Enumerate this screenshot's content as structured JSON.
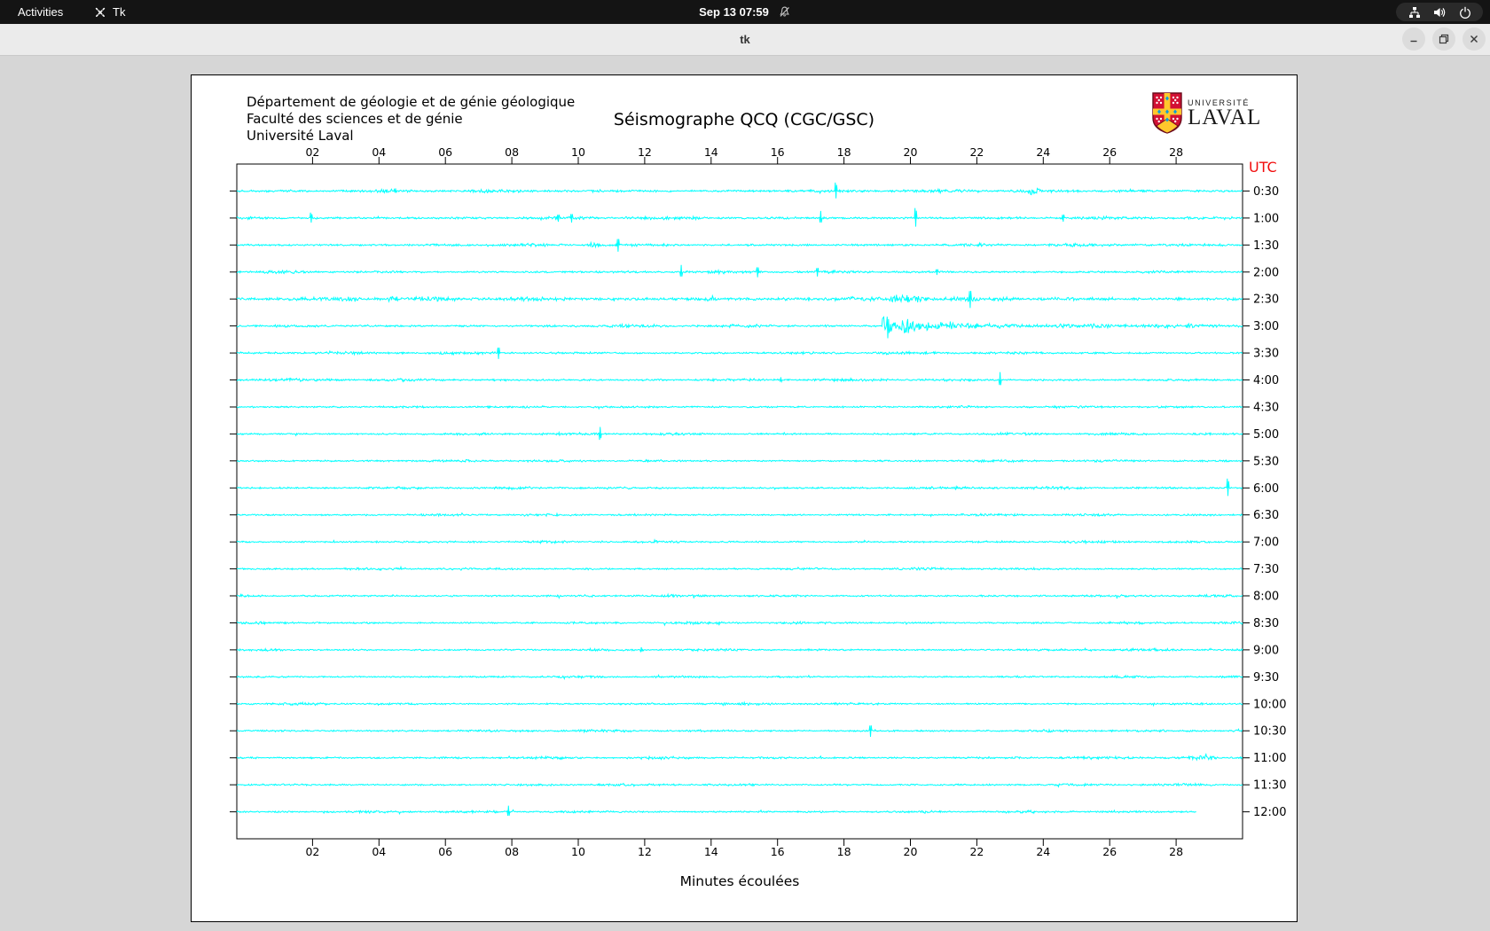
{
  "top_bar": {
    "activities_label": "Activities",
    "app_name": "Tk",
    "clock": "Sep 13 07:59",
    "icons": [
      "tk-app-icon",
      "notifications-muted-icon",
      "network-wired-icon",
      "volume-icon",
      "power-icon"
    ]
  },
  "window": {
    "title": "tk",
    "controls": [
      "minimize",
      "restore",
      "close"
    ]
  },
  "canvas": {
    "header_lines": [
      "Département de géologie et de génie géologique",
      "Faculté des sciences et de génie",
      "Université Laval"
    ],
    "title": "Séismographe QCQ (CGC/GSC)",
    "logo": {
      "line1": "UNIVERSITÉ",
      "line2": "LAVAL"
    }
  },
  "chart_data": {
    "type": "line",
    "title": "Séismographe QCQ (CGC/GSC)",
    "xlabel": "Minutes écoulées",
    "utc_label": "UTC",
    "utc_color": "#f10d0d",
    "trace_color": "#00ffff",
    "x_range": [
      0,
      30
    ],
    "x_ticks": [
      "02",
      "04",
      "06",
      "08",
      "10",
      "12",
      "14",
      "16",
      "18",
      "20",
      "22",
      "24",
      "26",
      "28"
    ],
    "x_tick_minutes": [
      2,
      4,
      6,
      8,
      10,
      12,
      14,
      16,
      18,
      20,
      22,
      24,
      26,
      28
    ],
    "rows": [
      {
        "label": "0:30",
        "amp": 1.7,
        "events": [
          {
            "t": "spike",
            "m": 4.5,
            "a": 3
          },
          {
            "t": "spike",
            "m": 17.75,
            "a": 11
          },
          {
            "t": "burst",
            "m0": 23.4,
            "m1": 24.1,
            "a": 3.5
          }
        ]
      },
      {
        "label": "1:00",
        "amp": 1.6,
        "events": [
          {
            "t": "spike",
            "m": 1.95,
            "a": 7
          },
          {
            "t": "spike",
            "m": 9.4,
            "a": 5
          },
          {
            "t": "spike",
            "m": 9.8,
            "a": 6
          },
          {
            "t": "spike",
            "m": 17.3,
            "a": 8
          },
          {
            "t": "spike",
            "m": 20.15,
            "a": 13
          },
          {
            "t": "spike",
            "m": 24.6,
            "a": 5
          }
        ]
      },
      {
        "label": "1:30",
        "amp": 1.6,
        "events": [
          {
            "t": "burst",
            "m0": 10.2,
            "m1": 10.7,
            "a": 3
          },
          {
            "t": "spike",
            "m": 11.2,
            "a": 9
          }
        ]
      },
      {
        "label": "2:00",
        "amp": 1.5,
        "events": [
          {
            "t": "spike",
            "m": 13.1,
            "a": 8
          },
          {
            "t": "spike",
            "m": 15.4,
            "a": 7
          },
          {
            "t": "spike",
            "m": 17.2,
            "a": 6
          },
          {
            "t": "spike",
            "m": 20.8,
            "a": 4
          }
        ]
      },
      {
        "label": "2:30",
        "amp": 2.3,
        "events": [
          {
            "t": "burst",
            "m0": 2.8,
            "m1": 3.4,
            "a": 2.5
          },
          {
            "t": "burst",
            "m0": 4.2,
            "m1": 4.7,
            "a": 2.5
          },
          {
            "t": "burst",
            "m0": 13.8,
            "m1": 14.3,
            "a": 2.5
          },
          {
            "t": "burst",
            "m0": 19.2,
            "m1": 20.6,
            "a": 4.5
          },
          {
            "t": "spike",
            "m": 21.8,
            "a": 12
          }
        ]
      },
      {
        "label": "3:00",
        "amp": 1.6,
        "events": [
          {
            "t": "quake",
            "m": 19.15,
            "a": 14,
            "tau": 1.1,
            "tail": 1.5
          }
        ]
      },
      {
        "label": "3:30",
        "amp": 1.5,
        "events": [
          {
            "t": "spike",
            "m": 7.6,
            "a": 8
          }
        ]
      },
      {
        "label": "4:00",
        "amp": 1.5,
        "events": [
          {
            "t": "spike",
            "m": 16.1,
            "a": 3
          },
          {
            "t": "spike",
            "m": 22.7,
            "a": 9
          }
        ]
      },
      {
        "label": "4:30",
        "amp": 1.3,
        "events": []
      },
      {
        "label": "5:00",
        "amp": 1.4,
        "events": [
          {
            "t": "spike",
            "m": 10.65,
            "a": 9
          }
        ]
      },
      {
        "label": "5:30",
        "amp": 1.3,
        "events": []
      },
      {
        "label": "6:00",
        "amp": 1.4,
        "events": [
          {
            "t": "spike",
            "m": 29.55,
            "a": 12
          }
        ]
      },
      {
        "label": "6:30",
        "amp": 1.3,
        "events": []
      },
      {
        "label": "7:00",
        "amp": 1.3,
        "events": []
      },
      {
        "label": "7:30",
        "amp": 1.3,
        "events": []
      },
      {
        "label": "8:00",
        "amp": 1.3,
        "events": []
      },
      {
        "label": "8:30",
        "amp": 1.3,
        "events": []
      },
      {
        "label": "9:00",
        "amp": 1.3,
        "events": [
          {
            "t": "spike",
            "m": 11.9,
            "a": 3
          }
        ]
      },
      {
        "label": "9:30",
        "amp": 1.2,
        "events": []
      },
      {
        "label": "10:00",
        "amp": 1.3,
        "events": []
      },
      {
        "label": "10:30",
        "amp": 1.3,
        "events": [
          {
            "t": "spike",
            "m": 18.8,
            "a": 8
          }
        ]
      },
      {
        "label": "11:00",
        "amp": 1.4,
        "events": [
          {
            "t": "burst",
            "m0": 28.3,
            "m1": 29.2,
            "a": 3.5
          }
        ]
      },
      {
        "label": "11:30",
        "amp": 1.3,
        "events": []
      },
      {
        "label": "12:00",
        "amp": 1.3,
        "end": 28.6,
        "events": [
          {
            "t": "spike",
            "m": 7.9,
            "a": 7
          }
        ]
      }
    ]
  }
}
